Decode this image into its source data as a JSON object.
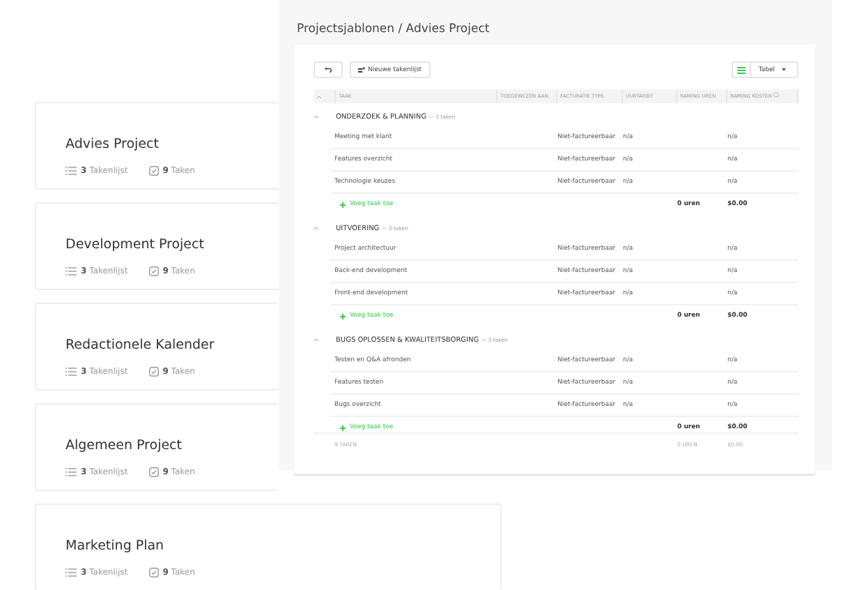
{
  "projects": [
    {
      "title": "Advies Project",
      "lists": "**3** Takenlijst",
      "tasks": "**9** Taken"
    },
    {
      "title": "Development Project",
      "lists": "**3** Takenlijst",
      "tasks": "**9** Taken"
    },
    {
      "title": "Redactionele Kalender",
      "lists": "**3** Takenlijst",
      "tasks": "**9** Taken"
    },
    {
      "title": "Algemeen Project",
      "lists": "**3** Takenlijst",
      "tasks": "**9** Taken"
    },
    {
      "title": "Marketing Plan",
      "lists": "**3** Takenlijst",
      "tasks": "**9** Taken"
    }
  ],
  "panel": {
    "breadcrumb": "Projectsjablonen / Advies Project",
    "new_list_button": "Nieuwe takenlijst",
    "view_dropdown": "Tabel",
    "columns": [
      "TAAK",
      "TOEGEWEZEN AAN",
      "FACTURATIE TYPE",
      "UURTARIEF",
      "RAMING UREN",
      "RAMING KOSTEN"
    ],
    "groups": [
      {
        "name": "ONDERZOEK & PLANNING",
        "count": "— 3 taken",
        "expanded": true,
        "add_label": "Voeg taak toe",
        "hours": "0 uren",
        "cost": "$0.00",
        "tasks": [
          {
            "name": "Meeting met klant",
            "billing": "Niet-factureerbaar",
            "rate": "n/a",
            "cost": "n/a"
          },
          {
            "name": "Features overzicht",
            "billing": "Niet-factureerbaar",
            "rate": "n/a",
            "cost": "n/a"
          },
          {
            "name": "Technologie keuzes",
            "billing": "Niet-factureerbaar",
            "rate": "n/a",
            "cost": "n/a"
          }
        ]
      },
      {
        "name": "UITVOERING",
        "count": "— 3 taken",
        "expanded": true,
        "add_label": "Voeg taak toe",
        "hours": "0 uren",
        "cost": "$0.00",
        "tasks": [
          {
            "name": "Project architectuur",
            "billing": "Niet-factureerbaar",
            "rate": "n/a",
            "cost": "n/a"
          },
          {
            "name": "Back-end development",
            "billing": "Niet-factureerbaar",
            "rate": "n/a",
            "cost": "n/a"
          },
          {
            "name": "Front-end development",
            "billing": "Niet-factureerbaar",
            "rate": "n/a",
            "cost": "n/a"
          }
        ]
      },
      {
        "name": "BUGS OPLOSSEN & KWALITEITSBORGING",
        "count": "— 3 taken",
        "expanded": true,
        "add_label": "Voeg taak toe",
        "hours": "0 uren",
        "cost": "$0.00",
        "tasks": [
          {
            "name": "Testen en Q&A afronden",
            "billing": "Niet-factureerbaar",
            "rate": "n/a",
            "cost": "n/a"
          },
          {
            "name": "Features testen",
            "billing": "Niet-factureerbaar",
            "rate": "n/a",
            "cost": "n/a"
          },
          {
            "name": "Bugs overzicht",
            "billing": "Niet-factureerbaar",
            "rate": "n/a",
            "cost": "n/a"
          }
        ]
      }
    ],
    "footer": {
      "tasks": "9 TAKEN",
      "hours": "0 UREN",
      "cost": "$0.00"
    }
  }
}
